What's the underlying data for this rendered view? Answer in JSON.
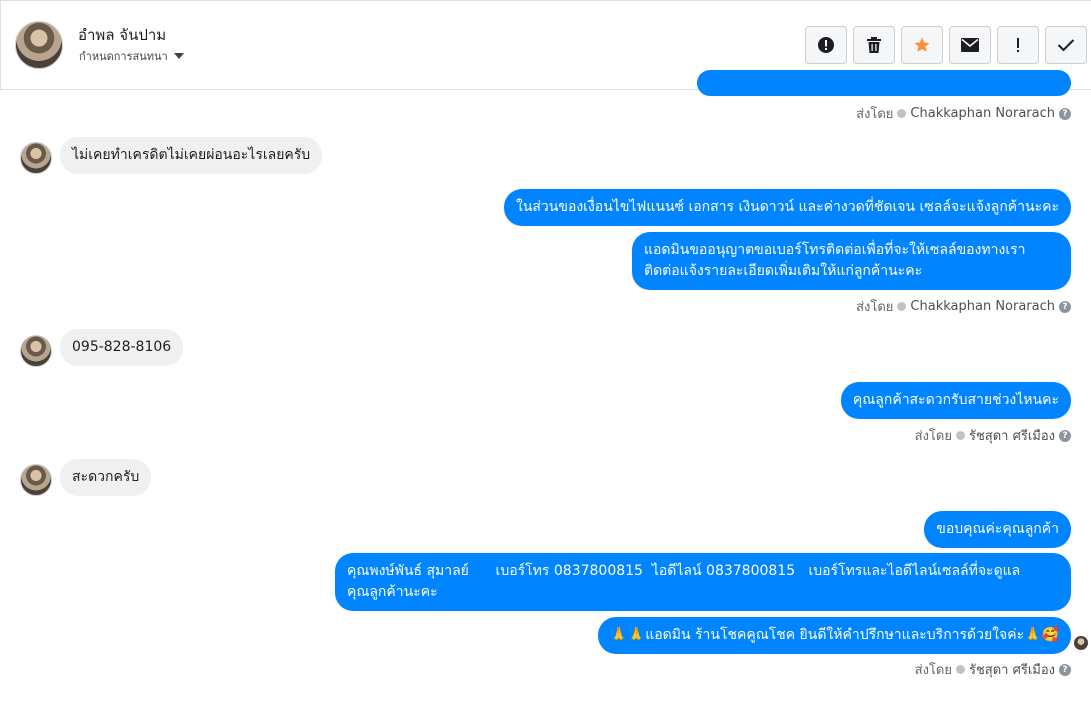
{
  "header": {
    "contact_name": "อำพล จันปาม",
    "subtitle": "กำหนดการสนทนา"
  },
  "actions": [
    {
      "name": "alert-icon"
    },
    {
      "name": "trash-icon"
    },
    {
      "name": "star-icon",
      "color": "#f7923a"
    },
    {
      "name": "envelope-icon"
    },
    {
      "name": "exclamation-icon"
    },
    {
      "name": "check-icon"
    }
  ],
  "messages": {
    "sent1_by_label": "ส่งโดย",
    "sent1_by_name": "Chakkaphan Norarach",
    "in1": "ไม่เคยทำเครดิตไม่เคยผ่อนอะไรเลยครับ",
    "out1": "ในส่วนของเงื่อนไขไฟแนนซ์ เอกสาร เงินดาวน์ และค่างวดที่ชัดเจน เซลล์จะแจ้งลูกค้านะคะ",
    "out2_line1": "แอดมินขออนุญาตขอเบอร์โทรติดต่อเพื่อที่จะให้เซลล์ของทางเรา",
    "out2_line2": "ติดต่อแจ้งรายละเอียดเพิ่มเติมให้แก่ลูกค้านะคะ",
    "sent2_by_label": "ส่งโดย",
    "sent2_by_name": "Chakkaphan Norarach",
    "in2": "095-828-8106",
    "out3": "คุณลูกค้าสะดวกรับสายช่วงไหนคะ",
    "sent3_by_label": "ส่งโดย",
    "sent3_by_name": "รัชสุดา ศรีเมือง",
    "in3": "สะดวกครับ",
    "out4": "ขอบคุณค่ะคุณลูกค้า",
    "out5_line1": "คุณพงษ์พันธ์ สุมาลย์      เบอร์โทร 0837800815  ไอดีไลน์ 0837800815   เบอร์โทรและไอดีไลน์เซลล์ที่จะดูแล",
    "out5_line2": "คุณลูกค้านะคะ",
    "out6": "🙏🙏แอดมิน ร้านโชคคูณโชค ยินดีให้คำปรึกษาและบริการด้วยใจค่ะ🙏🥰",
    "sent4_by_label": "ส่งโดย",
    "sent4_by_name": "รัชสุดา ศรีเมือง"
  }
}
